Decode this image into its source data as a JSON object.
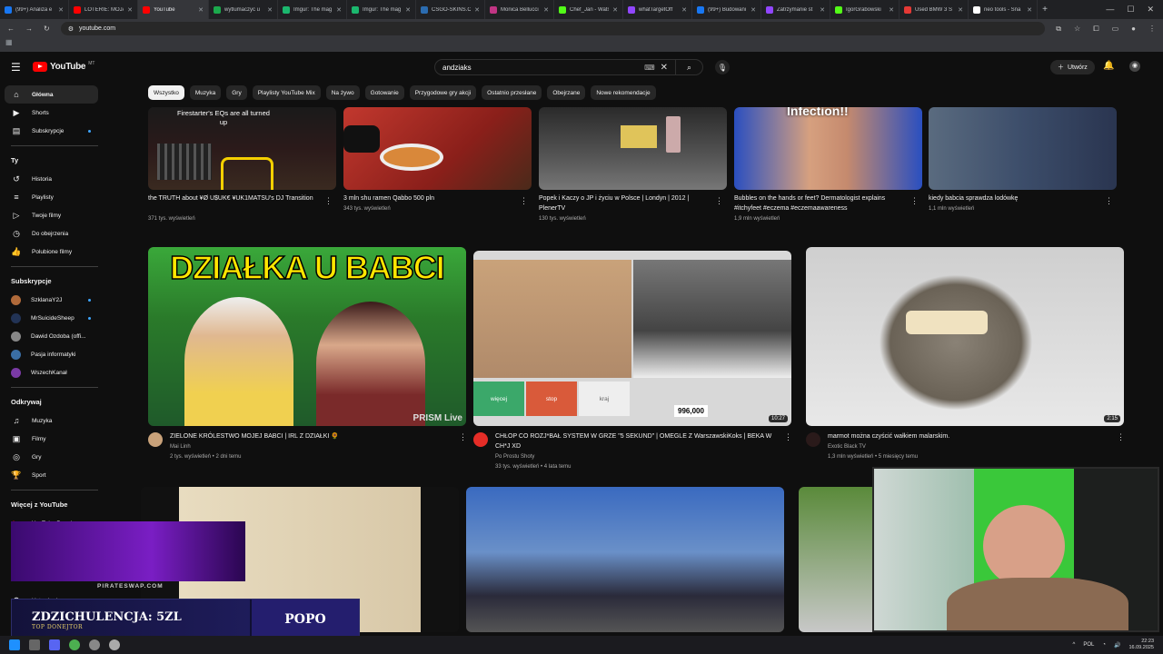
{
  "browser": {
    "tabs": [
      {
        "title": "(99+) Analiza e",
        "color": "#1877f2"
      },
      {
        "title": "LOTERIE: MOJA",
        "color": "#ff0000"
      },
      {
        "title": "YouTube",
        "color": "#ff0000",
        "active": true
      },
      {
        "title": "wytlumaczyc u",
        "color": "#1ba94c"
      },
      {
        "title": "Imgur: The mag",
        "color": "#1bb76e"
      },
      {
        "title": "Imgur: The mag",
        "color": "#1bb76e"
      },
      {
        "title": "CSGO-SKINS.C",
        "color": "#2b6cb0"
      },
      {
        "title": "Monica Bellucci",
        "color": "#c13584"
      },
      {
        "title": "Chef_Jan - Wats",
        "color": "#53fc18"
      },
      {
        "title": "whatTargetOff",
        "color": "#9146ff"
      },
      {
        "title": "(99+) Budowani",
        "color": "#1877f2"
      },
      {
        "title": "Zatrzymanie st",
        "color": "#9146ff"
      },
      {
        "title": "IgorGrabowski",
        "color": "#53fc18"
      },
      {
        "title": "Used BMW 3 S",
        "color": "#e53935"
      },
      {
        "title": "neo tools - Sna",
        "color": "#ffffff"
      }
    ],
    "url": "youtube.com"
  },
  "header": {
    "search_value": "andziaks",
    "create_label": "Utwórz"
  },
  "chips": [
    "Wszystko",
    "Muzyka",
    "Gry",
    "Playlisty YouTube Mix",
    "Na żywo",
    "Gotowanie",
    "Przygodowe gry akcji",
    "Ostatnio przesłane",
    "Obejrzane",
    "Nowe rekomendacje"
  ],
  "sidebar": {
    "main": [
      {
        "label": "Główna",
        "icon": "home-icon",
        "glyph": "⌂"
      },
      {
        "label": "Shorts",
        "icon": "shorts-icon",
        "glyph": "▶"
      },
      {
        "label": "Subskrypcje",
        "icon": "subscriptions-icon",
        "glyph": "▤"
      }
    ],
    "you_heading": "Ty",
    "you": [
      {
        "label": "Historia",
        "icon": "history-icon",
        "glyph": "↺"
      },
      {
        "label": "Playlisty",
        "icon": "playlist-icon",
        "glyph": "≡"
      },
      {
        "label": "Twoje filmy",
        "icon": "your-videos-icon",
        "glyph": "▷"
      },
      {
        "label": "Do obejrzenia",
        "icon": "watch-later-icon",
        "glyph": "◷"
      },
      {
        "label": "Polubione filmy",
        "icon": "liked-icon",
        "glyph": "👍"
      }
    ],
    "subs_heading": "Subskrypcje",
    "subs": [
      {
        "label": "SzklanaY2J",
        "color": "#b06a3a"
      },
      {
        "label": "MrSuicideSheep",
        "color": "#223355"
      },
      {
        "label": "Dawid Ozdoba (offi...",
        "color": "#888888"
      },
      {
        "label": "Pasja informatyki",
        "color": "#3a6ea5"
      },
      {
        "label": "WszechKanał",
        "color": "#7a3aa5"
      }
    ],
    "explore_heading": "Odkrywaj",
    "explore": [
      {
        "label": "Muzyka",
        "icon": "music-icon",
        "glyph": "♫"
      },
      {
        "label": "Filmy",
        "icon": "movies-icon",
        "glyph": "▣"
      },
      {
        "label": "Gry",
        "icon": "gaming-icon",
        "glyph": "◎"
      },
      {
        "label": "Sport",
        "icon": "sport-icon",
        "glyph": "🏆"
      }
    ],
    "more_heading": "Więcej z YouTube",
    "premium": "YouTube Premium",
    "settings": "Ustawienia"
  },
  "row1": [
    {
      "title": "the TRUTH about ¥Ø U$UK€ ¥UK1MATSU's DJ Transition",
      "meta": "371 tys. wyświetleń",
      "thumb_text": "Firestarter's EQs are all turned up"
    },
    {
      "title": "3 mln shu ramen Qabbo 500 pln",
      "meta": "343 tys. wyświetleń"
    },
    {
      "title": "Popek i Kaczy o JP i życiu w Polsce | Londyn | 2012 | PlenerTV",
      "meta": "130 tys. wyświetleń"
    },
    {
      "title": "Bubbles on the hands or feet? Dermatologist explains #itchyfeet #eczema #eczemaawareness",
      "meta": "1,9 mln wyświetleń",
      "thumb_text": "Infection!!"
    },
    {
      "title": "kiedy babcia sprawdza lodówkę",
      "meta": "1,1 mln wyświetleń"
    }
  ],
  "row2": [
    {
      "title": "ZIELONE KRÓLESTWO MOJEJ BABCI | IRL Z DZIAŁKI 🌻",
      "channel": "Mai Linh",
      "meta": "2 tys. wyświetleń • 2 dni temu",
      "thumb_text": "DZIAŁKA U BABCI",
      "badge": "PRISM Live"
    },
    {
      "title": "CHŁOP CO ROZJ*BAŁ SYSTEM W GRZE \"5 SEKUND\" | OMEGLE Z WarszawskiKoks | BEKA W CH*J XD",
      "channel": "Po Prostu Shoty",
      "meta": "33 tys. wyświetleń • 4 lata temu",
      "duration": "10:27",
      "counter": "996,000",
      "btn1": "więcej",
      "btn2": "stop",
      "btn3": "kraj"
    },
    {
      "title": "marmot można czyścić wałkiem malarskim.",
      "channel": "Exotic Black TV",
      "meta": "1,3 mln wyświetleń • 5 miesięcy temu",
      "duration": "2:15"
    }
  ],
  "overlay": {
    "pirate": "PIRATESWAP.COM",
    "donation": "ZDZICHULENCJA: 5ZL",
    "donation_sub": "TOP DONEJTOR",
    "name": "POPO"
  },
  "taskbar": {
    "lang": "POL",
    "time": "22:23",
    "date": "16.09.2025"
  }
}
